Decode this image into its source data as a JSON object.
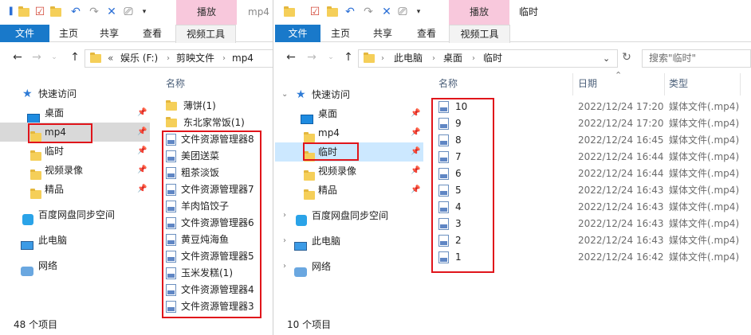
{
  "left": {
    "context_tab": "播放",
    "context_title": "mp4",
    "tabs": {
      "file": "文件",
      "home": "主页",
      "share": "共享",
      "view": "查看",
      "video_tools": "视频工具"
    },
    "address": {
      "overflow": "«",
      "parts": [
        "娱乐 (F:)",
        "剪映文件",
        "mp4"
      ]
    },
    "nav": {
      "quick_access": "快速访问",
      "items": [
        "桌面",
        "mp4",
        "临时",
        "视频录像",
        "精品"
      ],
      "baidu": "百度网盘同步空间",
      "this_pc": "此电脑",
      "network": "网络"
    },
    "column_name": "名称",
    "folders": [
      "薄饼(1)",
      "东北家常饭(1)"
    ],
    "files": [
      "文件资源管理器8",
      "美团送菜",
      "粗茶淡饭",
      "文件资源管理器7",
      "羊肉馅饺子",
      "文件资源管理器6",
      "黄豆炖海鱼",
      "文件资源管理器5",
      "玉米发糕(1)",
      "文件资源管理器4",
      "文件资源管理器3"
    ],
    "status": "48 个项目"
  },
  "right": {
    "context_tab": "播放",
    "context_title": "临时",
    "tabs": {
      "file": "文件",
      "home": "主页",
      "share": "共享",
      "view": "查看",
      "video_tools": "视频工具"
    },
    "address": {
      "parts": [
        "此电脑",
        "桌面",
        "临时"
      ]
    },
    "search_placeholder": "搜索\"临时\"",
    "nav": {
      "quick_access": "快速访问",
      "items": [
        "桌面",
        "mp4",
        "临时",
        "视频录像",
        "精品"
      ],
      "baidu": "百度网盘同步空间",
      "this_pc": "此电脑",
      "network": "网络"
    },
    "columns": {
      "name": "名称",
      "date": "日期",
      "type": "类型"
    },
    "files": [
      {
        "name": "10",
        "date": "2022/12/24 17:20",
        "type": "媒体文件(.mp4)"
      },
      {
        "name": "9",
        "date": "2022/12/24 17:20",
        "type": "媒体文件(.mp4)"
      },
      {
        "name": "8",
        "date": "2022/12/24 16:45",
        "type": "媒体文件(.mp4)"
      },
      {
        "name": "7",
        "date": "2022/12/24 16:44",
        "type": "媒体文件(.mp4)"
      },
      {
        "name": "6",
        "date": "2022/12/24 16:44",
        "type": "媒体文件(.mp4)"
      },
      {
        "name": "5",
        "date": "2022/12/24 16:43",
        "type": "媒体文件(.mp4)"
      },
      {
        "name": "4",
        "date": "2022/12/24 16:43",
        "type": "媒体文件(.mp4)"
      },
      {
        "name": "3",
        "date": "2022/12/24 16:43",
        "type": "媒体文件(.mp4)"
      },
      {
        "name": "2",
        "date": "2022/12/24 16:43",
        "type": "媒体文件(.mp4)"
      },
      {
        "name": "1",
        "date": "2022/12/24 16:42",
        "type": "媒体文件(.mp4)"
      }
    ],
    "status": "10 个项目"
  },
  "colors": {
    "accent": "#1979ca",
    "context": "#f8c8dc",
    "highlight": "#e0151b",
    "selection": "#cce8ff"
  }
}
